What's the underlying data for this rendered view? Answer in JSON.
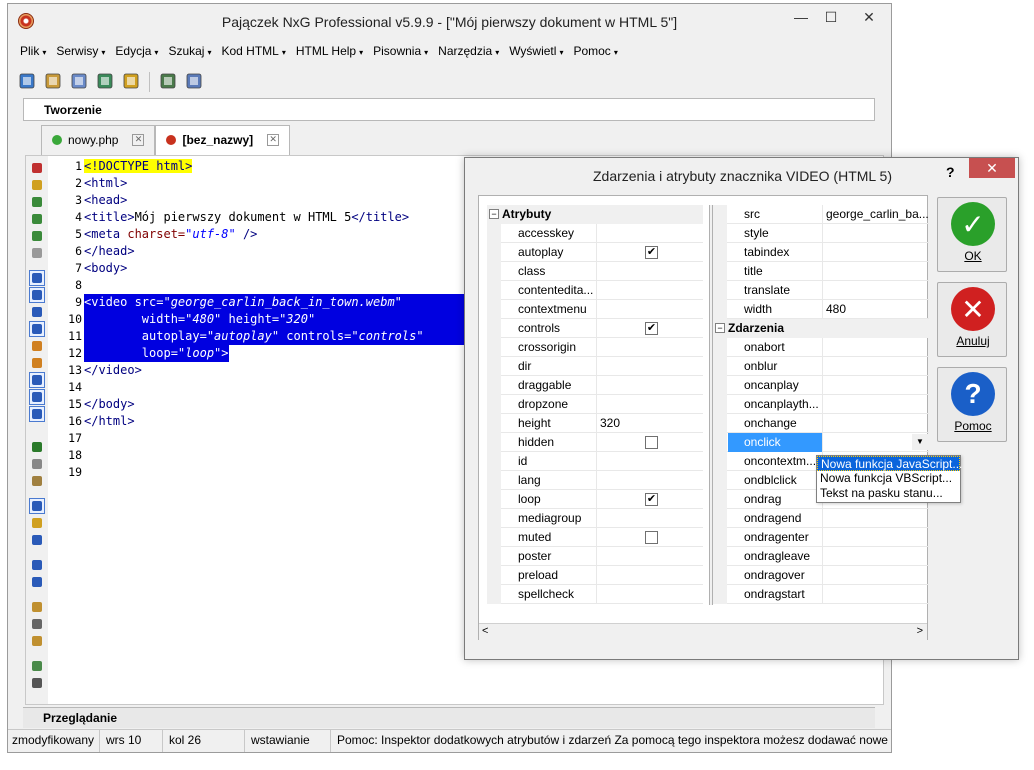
{
  "window": {
    "title": "Pajączek NxG Professional v5.9.9 - [\"Mój pierwszy dokument w HTML 5\"]"
  },
  "menu": [
    {
      "label": "Plik"
    },
    {
      "label": "Serwisy"
    },
    {
      "label": "Edycja"
    },
    {
      "label": "Szukaj"
    },
    {
      "label": "Kod HTML"
    },
    {
      "label": "HTML Help"
    },
    {
      "label": "Pisownia"
    },
    {
      "label": "Narzędzia"
    },
    {
      "label": "Wyświetl"
    },
    {
      "label": "Pomoc"
    }
  ],
  "toolbar_icons": [
    "browser-preview-icon",
    "frame-icon",
    "copy-file-icon",
    "image-icon",
    "table-icon",
    "magic-wand-icon",
    "fill-icon"
  ],
  "groups": {
    "create_label": "Tworzenie",
    "preview_label": "Przeglądanie"
  },
  "tabs": [
    {
      "label": "nowy.php",
      "dot_color": "#3aa83a"
    },
    {
      "label": "[bez_nazwy]",
      "dot_color": "#c8321e"
    }
  ],
  "editor": {
    "line_numbers": [
      "1",
      "2",
      "3",
      "4",
      "5",
      "6",
      "7",
      "8",
      "9",
      "10",
      "11",
      "12",
      "13",
      "14",
      "15",
      "16",
      "17",
      "18",
      "19"
    ],
    "lines": {
      "l1": "<!DOCTYPE html>",
      "l2": "<html>",
      "l3": "<head>",
      "l4_open": "<title>",
      "l4_text": "Mój pierwszy dokument w HTML 5",
      "l4_close": "</title>",
      "l5_tag": "<meta",
      "l5_attr": " charset=",
      "l5_val": "\"utf-8\"",
      "l5_end": " />",
      "l6": "</head>",
      "l7": "<body>",
      "l9_tag": "<video",
      "l9_attr": " src=",
      "l9_val": "\"george_carlin_back_in_town.webm\"",
      "l10_attr": "width=",
      "l10_val": "\"480\"",
      "l10_attr2": " height=",
      "l10_val2": "\"320\"",
      "l11_attr": "autoplay=",
      "l11_val": "\"autoplay\"",
      "l11_attr2": " controls=",
      "l11_val2": "\"controls\"",
      "l12_attr": "loop=",
      "l12_val": "\"loop\"",
      "l12_end": ">",
      "l13": "</video>",
      "l15": "</body>",
      "l16": "</html>"
    }
  },
  "statusbar": {
    "modified": "zmodyfikowany",
    "row": "wrs 10",
    "col": "kol 26",
    "mode": "wstawianie",
    "help": "Pomoc: Inspektor dodatkowych atrybutów i zdarzeń  Za pomocą tego inspektora możesz dodawać nowe"
  },
  "dialog": {
    "title": "Zdarzenia i atrybuty znacznika VIDEO (HTML 5)",
    "help_glyph": "?",
    "close_glyph": "✕",
    "attributes_header": "Atrybuty",
    "events_header": "Zdarzenia",
    "attributes_left": [
      {
        "name": "accesskey",
        "value": "",
        "checkbox": null
      },
      {
        "name": "autoplay",
        "value": "",
        "checkbox": true
      },
      {
        "name": "class",
        "value": "",
        "checkbox": null
      },
      {
        "name": "contentedita...",
        "value": "",
        "checkbox": null
      },
      {
        "name": "contextmenu",
        "value": "",
        "checkbox": null
      },
      {
        "name": "controls",
        "value": "",
        "checkbox": true
      },
      {
        "name": "crossorigin",
        "value": "",
        "checkbox": null
      },
      {
        "name": "dir",
        "value": "",
        "checkbox": null
      },
      {
        "name": "draggable",
        "value": "",
        "checkbox": null
      },
      {
        "name": "dropzone",
        "value": "",
        "checkbox": null
      },
      {
        "name": "height",
        "value": "320",
        "checkbox": null
      },
      {
        "name": "hidden",
        "value": "",
        "checkbox": false
      },
      {
        "name": "id",
        "value": "",
        "checkbox": null
      },
      {
        "name": "lang",
        "value": "",
        "checkbox": null
      },
      {
        "name": "loop",
        "value": "",
        "checkbox": true
      },
      {
        "name": "mediagroup",
        "value": "",
        "checkbox": null
      },
      {
        "name": "muted",
        "value": "",
        "checkbox": false
      },
      {
        "name": "poster",
        "value": "",
        "checkbox": null
      },
      {
        "name": "preload",
        "value": "",
        "checkbox": null
      },
      {
        "name": "spellcheck",
        "value": "",
        "checkbox": null
      }
    ],
    "attributes_right": [
      {
        "name": "src",
        "value": "george_carlin_ba..."
      },
      {
        "name": "style",
        "value": ""
      },
      {
        "name": "tabindex",
        "value": ""
      },
      {
        "name": "title",
        "value": ""
      },
      {
        "name": "translate",
        "value": ""
      },
      {
        "name": "width",
        "value": "480"
      }
    ],
    "events": [
      {
        "name": "onabort"
      },
      {
        "name": "onblur"
      },
      {
        "name": "oncanplay"
      },
      {
        "name": "oncanplayth..."
      },
      {
        "name": "onchange"
      },
      {
        "name": "onclick",
        "selected": true
      },
      {
        "name": "oncontextm..."
      },
      {
        "name": "ondblclick"
      },
      {
        "name": "ondrag"
      },
      {
        "name": "ondragend"
      },
      {
        "name": "ondragenter"
      },
      {
        "name": "ondragleave"
      },
      {
        "name": "ondragover"
      },
      {
        "name": "ondragstart"
      }
    ],
    "popup": [
      "Nowa funkcja JavaScript...",
      "Nowa funkcja VBScript...",
      "Tekst na pasku stanu..."
    ],
    "buttons": {
      "ok": {
        "label": "OK",
        "color": "#2aa02a"
      },
      "cancel": {
        "label": "Anuluj",
        "color": "#d02020"
      },
      "help": {
        "label": "Pomoc",
        "color": "#1a5fc8"
      }
    },
    "checkmark_glyph": "✔"
  }
}
